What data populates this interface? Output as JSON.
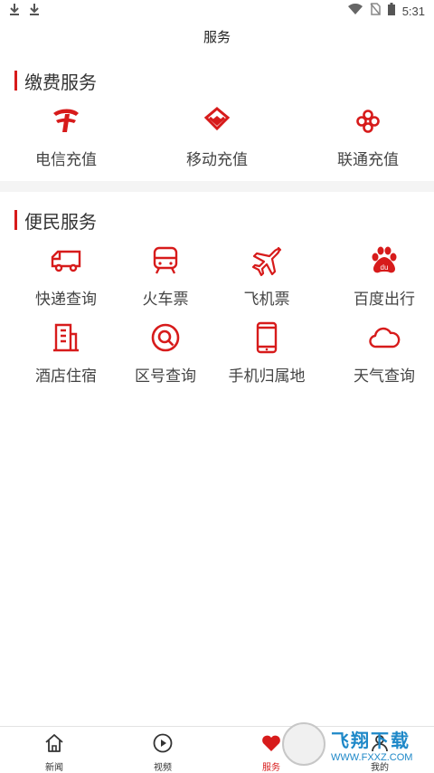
{
  "status_bar": {
    "time": "5:31"
  },
  "header": {
    "title": "服务"
  },
  "payment": {
    "title": "缴费服务",
    "items": [
      {
        "label": "电信充值",
        "icon": "china-telecom-icon"
      },
      {
        "label": "移动充值",
        "icon": "china-mobile-icon"
      },
      {
        "label": "联通充值",
        "icon": "china-unicom-icon"
      }
    ]
  },
  "convenience": {
    "title": "便民服务",
    "items": [
      {
        "label": "快递查询",
        "icon": "delivery-truck-icon"
      },
      {
        "label": "火车票",
        "icon": "train-icon"
      },
      {
        "label": "飞机票",
        "icon": "airplane-icon"
      },
      {
        "label": "百度出行",
        "icon": "baidu-paw-icon"
      },
      {
        "label": "酒店住宿",
        "icon": "hotel-building-icon"
      },
      {
        "label": "区号查询",
        "icon": "search-magnifier-icon"
      },
      {
        "label": "手机归属地",
        "icon": "mobile-phone-icon"
      },
      {
        "label": "天气查询",
        "icon": "cloud-icon"
      }
    ]
  },
  "tabs": [
    {
      "label": "新闻",
      "icon": "home-icon"
    },
    {
      "label": "视频",
      "icon": "play-circle-icon"
    },
    {
      "label": "服务",
      "icon": "heart-icon",
      "active": true
    },
    {
      "label": "我的",
      "icon": "person-icon"
    }
  ],
  "watermark": {
    "title": "飞翔下载",
    "url": "WWW.FXXZ.COM"
  },
  "colors": {
    "accent": "#d71b1b",
    "divider": "#f4f4f4"
  }
}
